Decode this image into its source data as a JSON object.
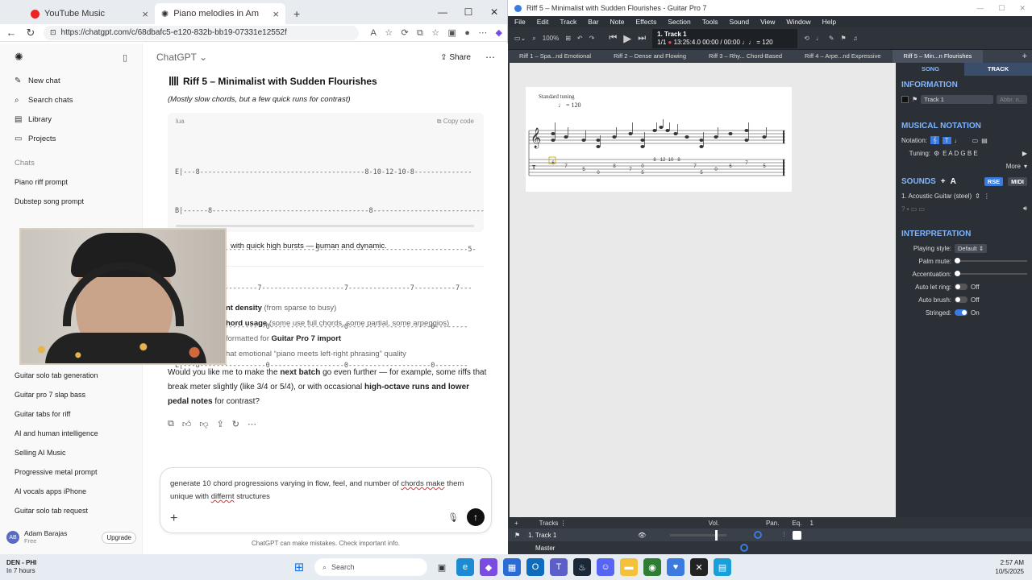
{
  "browser": {
    "tabs": [
      {
        "label": "YouTube Music"
      },
      {
        "label": "Piano melodies in Am"
      }
    ],
    "new_tab": "+",
    "url": "https://chatgpt.com/c/68dbafc5-e120-832b-bb19-07331e12552f"
  },
  "sidebar": {
    "items": [
      {
        "label": "New chat",
        "icon": "edit-icon"
      },
      {
        "label": "Search chats",
        "icon": "search-icon"
      },
      {
        "label": "Library",
        "icon": "library-icon"
      },
      {
        "label": "Projects",
        "icon": "folder-icon"
      }
    ],
    "chats_label": "Chats",
    "history": [
      "Piano riff prompt",
      "Dubstep song prompt",
      "Guitar solo tab generation",
      "Guitar pro 7 slap bass",
      "Guitar tabs for riff",
      "AI and human intelligence",
      "Selling AI Music",
      "Progressive metal prompt",
      "AI vocals apps iPhone",
      "Guitar solo tab request"
    ],
    "user": {
      "initials": "AB",
      "name": "Adam Barajas",
      "plan": "Free",
      "upgrade": "Upgrade"
    }
  },
  "chat": {
    "header": "ChatGPT",
    "share": "Share",
    "riff_title": "Riff 5 – Minimalist with Sudden Flourishes",
    "riff_subtitle": "(Mostly slow chords, but a few quick runs for contrast)",
    "code_lang": "lua",
    "copy_code": "Copy code",
    "tab_lines": [
      "E|---8----------------------------------------8-10-12-10-8--------------",
      "B|------8--------------------------------------8---------------------------",
      "G|---5----------------------------5------------------------------------5-",
      "D|---------7--------7--------------------7---------------7----------7---",
      "A|---8----------------0------------------0--------------------0--------",
      "E|---8----------------0------------------0--------------------0--------"
    ],
    "line1": "with quick high bursts — human and dynamic.",
    "bullets": [
      {
        "bold": "nt density",
        "rest": " (from sparse to busy)"
      },
      {
        "bold": "hord usage",
        "rest": " (some use full chords, some partial, some arpeggios)"
      },
      {
        "pre": "formatted for ",
        "bold": "Guitar Pro 7 import",
        "rest": ""
      },
      {
        "rest": "hat emotional “piano meets left-right phrasing” quality"
      }
    ],
    "para": {
      "p1": "Would you like me to make the ",
      "b1": "next batch",
      "p2": " go even further — for example, some riffs that break meter slightly (like 3/4 or 5/4), or with occasional ",
      "b2": "high-octave runs and lower pedal notes",
      "p3": " for contrast?"
    },
    "compose": {
      "t1": "generate 10 chord progressions varying in flow, feel, and number of ",
      "s1": "chords make",
      "t2": " them unique with ",
      "s2": "differnt",
      "t3": " structures"
    },
    "disclaimer": "ChatGPT can make mistakes. Check important info."
  },
  "gp": {
    "title": "Riff 5 – Minimalist with Sudden Flourishes - Guitar Pro 7",
    "menu": [
      "File",
      "Edit",
      "Track",
      "Bar",
      "Note",
      "Effects",
      "Section",
      "Tools",
      "Sound",
      "View",
      "Window",
      "Help"
    ],
    "zoom": "100%",
    "lcd": {
      "track": "1. Track 1",
      "bar": "1/1",
      "time": "13:25:4.0",
      "duration": "00:00 / 00:00",
      "tempo": "= 120"
    },
    "tabs": [
      "Riff 1 – Spa...nd Emotional",
      "Riff 2 – Dense and Flowing",
      "Riff 3 – Rhy... Chord-Based",
      "Riff 4 – Arpe...nd Expressive",
      "Riff 5 – Min...n Flourishes"
    ],
    "score": {
      "tuning": "Standard tuning",
      "tempo": "= 120",
      "tab_numbers": [
        "6",
        "7",
        "5",
        "0",
        "8",
        "7",
        "5",
        "0",
        "8",
        "12",
        "10",
        "8",
        "7",
        "5",
        "0",
        "6",
        "7",
        "5"
      ]
    },
    "panel": {
      "song_tab": "SONG",
      "track_tab": "TRACK",
      "info_h": "INFORMATION",
      "track_name": "Track 1",
      "abbr": "Abbr. n...",
      "notation_h": "MUSICAL NOTATION",
      "notation_label": "Notation:",
      "tuning_label": "Tuning:",
      "tuning_value": "E A D G B E",
      "more": "More",
      "sounds_h": "SOUNDS",
      "rse": "RSE",
      "midi": "MIDI",
      "sound": "1. Acoustic Guitar (steel)",
      "interp_h": "INTERPRETATION",
      "playing_style_label": "Playing style:",
      "playing_style": "Default",
      "palm_mute": "Palm mute:",
      "accentuation": "Accentuation:",
      "auto_let_ring": "Auto let ring:",
      "auto_let_ring_v": "Off",
      "auto_brush": "Auto brush:",
      "auto_brush_v": "Off",
      "stringed": "Stringed:",
      "stringed_v": "On"
    },
    "mixer": {
      "tracks": "Tracks",
      "vol": "Vol.",
      "pan": "Pan.",
      "eq": "Eq.",
      "num": "1",
      "track1": "1. Track 1",
      "master": "Master"
    }
  },
  "taskbar": {
    "weather_temp": "DEN - PHI",
    "weather_sub": "In 7 hours",
    "search": "Search",
    "time": "2:57 AM",
    "date": "10/5/2025"
  }
}
